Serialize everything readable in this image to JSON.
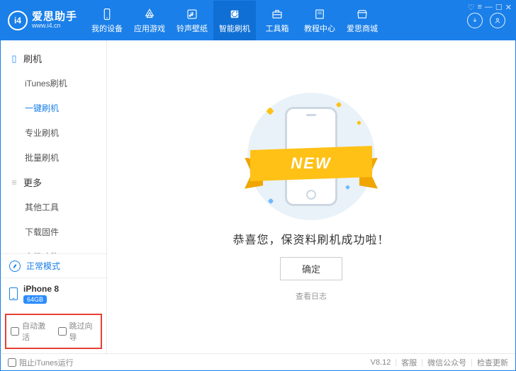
{
  "app": {
    "name": "爱思助手",
    "url": "www.i4.cn",
    "logo_letters": "i4"
  },
  "window_controls": [
    "♡",
    "≡",
    "—",
    "☐",
    "✕"
  ],
  "nav": [
    {
      "label": "我的设备",
      "icon": "phone"
    },
    {
      "label": "应用游戏",
      "icon": "apps"
    },
    {
      "label": "铃声壁纸",
      "icon": "music"
    },
    {
      "label": "智能刷机",
      "icon": "flash",
      "active": true
    },
    {
      "label": "工具箱",
      "icon": "toolbox"
    },
    {
      "label": "教程中心",
      "icon": "book"
    },
    {
      "label": "爱思商城",
      "icon": "store"
    }
  ],
  "sidebar": {
    "section_flash_title": "刷机",
    "flash_items": [
      {
        "label": "iTunes刷机"
      },
      {
        "label": "一键刷机",
        "active": true
      },
      {
        "label": "专业刷机"
      },
      {
        "label": "批量刷机"
      }
    ],
    "section_more_title": "更多",
    "more_items": [
      {
        "label": "其他工具"
      },
      {
        "label": "下载固件"
      },
      {
        "label": "高级功能"
      }
    ],
    "mode_label": "正常模式",
    "device": {
      "name": "iPhone 8",
      "capacity": "64GB"
    },
    "options": {
      "auto_activate": "自动激活",
      "skip_setup": "跳过向导"
    }
  },
  "main": {
    "ribbon_text": "NEW",
    "success_text": "恭喜您，保资料刷机成功啦！",
    "ok_label": "确定",
    "log_label": "查看日志"
  },
  "status": {
    "prevent_itunes": "阻止iTunes运行",
    "version": "V8.12",
    "support": "客服",
    "wechat": "微信公众号",
    "update": "检查更新"
  }
}
